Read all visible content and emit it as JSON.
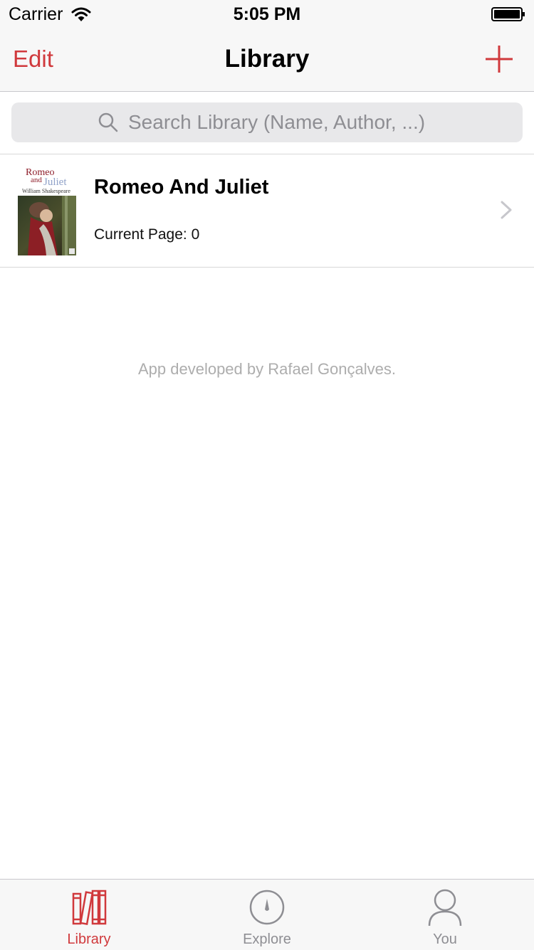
{
  "status_bar": {
    "carrier": "Carrier",
    "time": "5:05 PM"
  },
  "nav": {
    "edit_label": "Edit",
    "title": "Library",
    "add_icon": "plus-icon"
  },
  "search": {
    "placeholder": "Search Library (Name, Author, ...)"
  },
  "books": [
    {
      "title": "Romeo And Juliet",
      "current_page": "Current Page: 0",
      "cover": {
        "line1": "Romeo",
        "line2": "and",
        "line3": "Juliet",
        "author": "William Shakespeare"
      }
    }
  ],
  "footer": {
    "credit": "App developed by Rafael Gonçalves."
  },
  "tabs": [
    {
      "label": "Library",
      "icon": "books-icon",
      "active": true
    },
    {
      "label": "Explore",
      "icon": "compass-icon",
      "active": false
    },
    {
      "label": "You",
      "icon": "person-icon",
      "active": false
    }
  ],
  "colors": {
    "accent": "#d0393c",
    "inactive": "#8e8e93",
    "bar_bg": "#f7f7f7"
  }
}
